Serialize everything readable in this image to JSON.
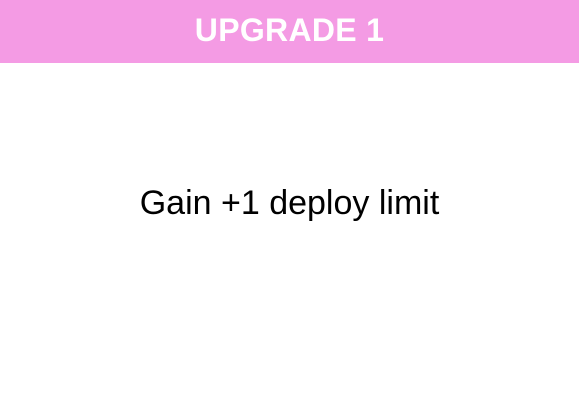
{
  "card": {
    "title": "UPGRADE 1",
    "description": "Gain +1 deploy limit"
  },
  "colors": {
    "header_background": "#f49be4",
    "title_text": "#ffffff",
    "description_text": "#000000",
    "card_background": "#ffffff"
  }
}
